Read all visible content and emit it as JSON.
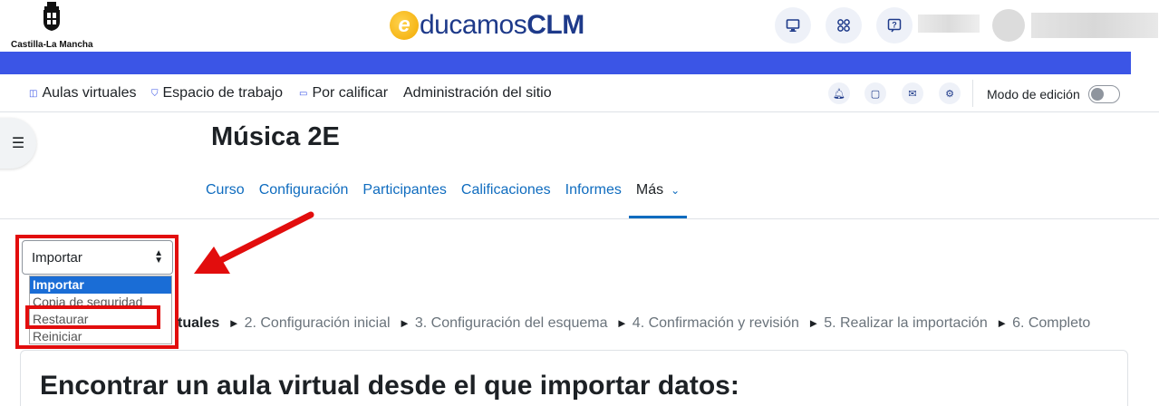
{
  "header": {
    "jccm_logo_text": "Castilla-La Mancha",
    "brand_e": "e",
    "brand_rest": "ducamos",
    "brand_bold": "CLM",
    "buttons": [
      {
        "name": "desktop-icon"
      },
      {
        "name": "apps-grid-icon"
      },
      {
        "name": "help-icon"
      }
    ]
  },
  "primary_nav": {
    "items": [
      {
        "icon": "aulas-icon",
        "label": "Aulas virtuales"
      },
      {
        "icon": "shield-icon",
        "label": "Espacio de trabajo"
      },
      {
        "icon": "grading-icon",
        "label": "Por calificar"
      },
      {
        "icon": "",
        "label": "Administración del sitio"
      }
    ],
    "circle_icons": [
      "bell-icon",
      "chat-icon",
      "mail-icon",
      "settings-icon"
    ],
    "edit_mode_label": "Modo de edición",
    "edit_mode_on": false
  },
  "course": {
    "title": "Música 2E",
    "tabs": [
      {
        "label": "Curso",
        "active": false
      },
      {
        "label": "Configuración",
        "active": false
      },
      {
        "label": "Participantes",
        "active": false
      },
      {
        "label": "Calificaciones",
        "active": false
      },
      {
        "label": "Informes",
        "active": false
      },
      {
        "label": "Más",
        "active": true
      }
    ]
  },
  "action_select": {
    "value": "Importar",
    "options": [
      "Importar",
      "Copia de seguridad",
      "Restaurar",
      "Reiniciar"
    ],
    "highlighted_option": "Restaurar"
  },
  "steps": {
    "first": "tuales",
    "rest": [
      "2. Configuración inicial",
      "3. Configuración del esquema",
      "4. Confirmación y revisión",
      "5. Realizar la importación",
      "6. Completo"
    ],
    "separator": "►"
  },
  "card": {
    "title": "Encontrar un aula virtual desde el que importar datos:"
  },
  "colors": {
    "accent_blue": "#3b55e6",
    "link_blue": "#0f6cbf",
    "highlight_red": "#e20d0d",
    "selected_option_bg": "#1a6dd6"
  }
}
